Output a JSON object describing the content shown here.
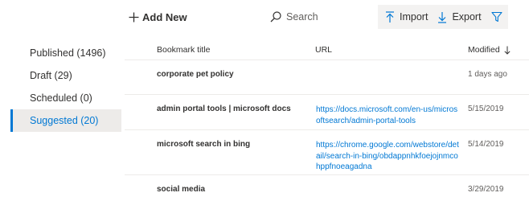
{
  "toolbar": {
    "add_new_label": "Add New",
    "search_placeholder": "Search",
    "import_label": "Import",
    "export_label": "Export"
  },
  "icons": {
    "add": "plus-icon",
    "search": "search-icon",
    "import": "import-arrow-icon",
    "export": "export-arrow-icon",
    "filter": "filter-funnel-icon",
    "sort": "sort-descending-icon"
  },
  "colors": {
    "accent": "#0078d4",
    "active_bg": "#edebe9",
    "command_bar_bg": "#f3f2f1",
    "text": "#323130",
    "muted_text": "#605e5c"
  },
  "sidebar": {
    "items": [
      {
        "label": "Published (1496)"
      },
      {
        "label": "Draft (29)"
      },
      {
        "label": "Scheduled (0)"
      },
      {
        "label": "Suggested (20)",
        "active": true
      }
    ]
  },
  "table": {
    "columns": [
      "Bookmark title",
      "URL",
      "Modified"
    ],
    "rows": [
      {
        "title": "corporate pet policy",
        "url": "",
        "modified": "1 days ago"
      },
      {
        "title": "admin portal tools | microsoft docs",
        "url": "https://docs.microsoft.com/en-us/microsoftsearch/admin-portal-tools",
        "modified": "5/15/2019"
      },
      {
        "title": "microsoft search in bing",
        "url": "https://chrome.google.com/webstore/detail/search-in-bing/obdappnhkfoejojnmcohppfnoeagadna",
        "modified": "5/14/2019"
      },
      {
        "title": "social media",
        "url": "",
        "modified": "3/29/2019"
      }
    ]
  }
}
